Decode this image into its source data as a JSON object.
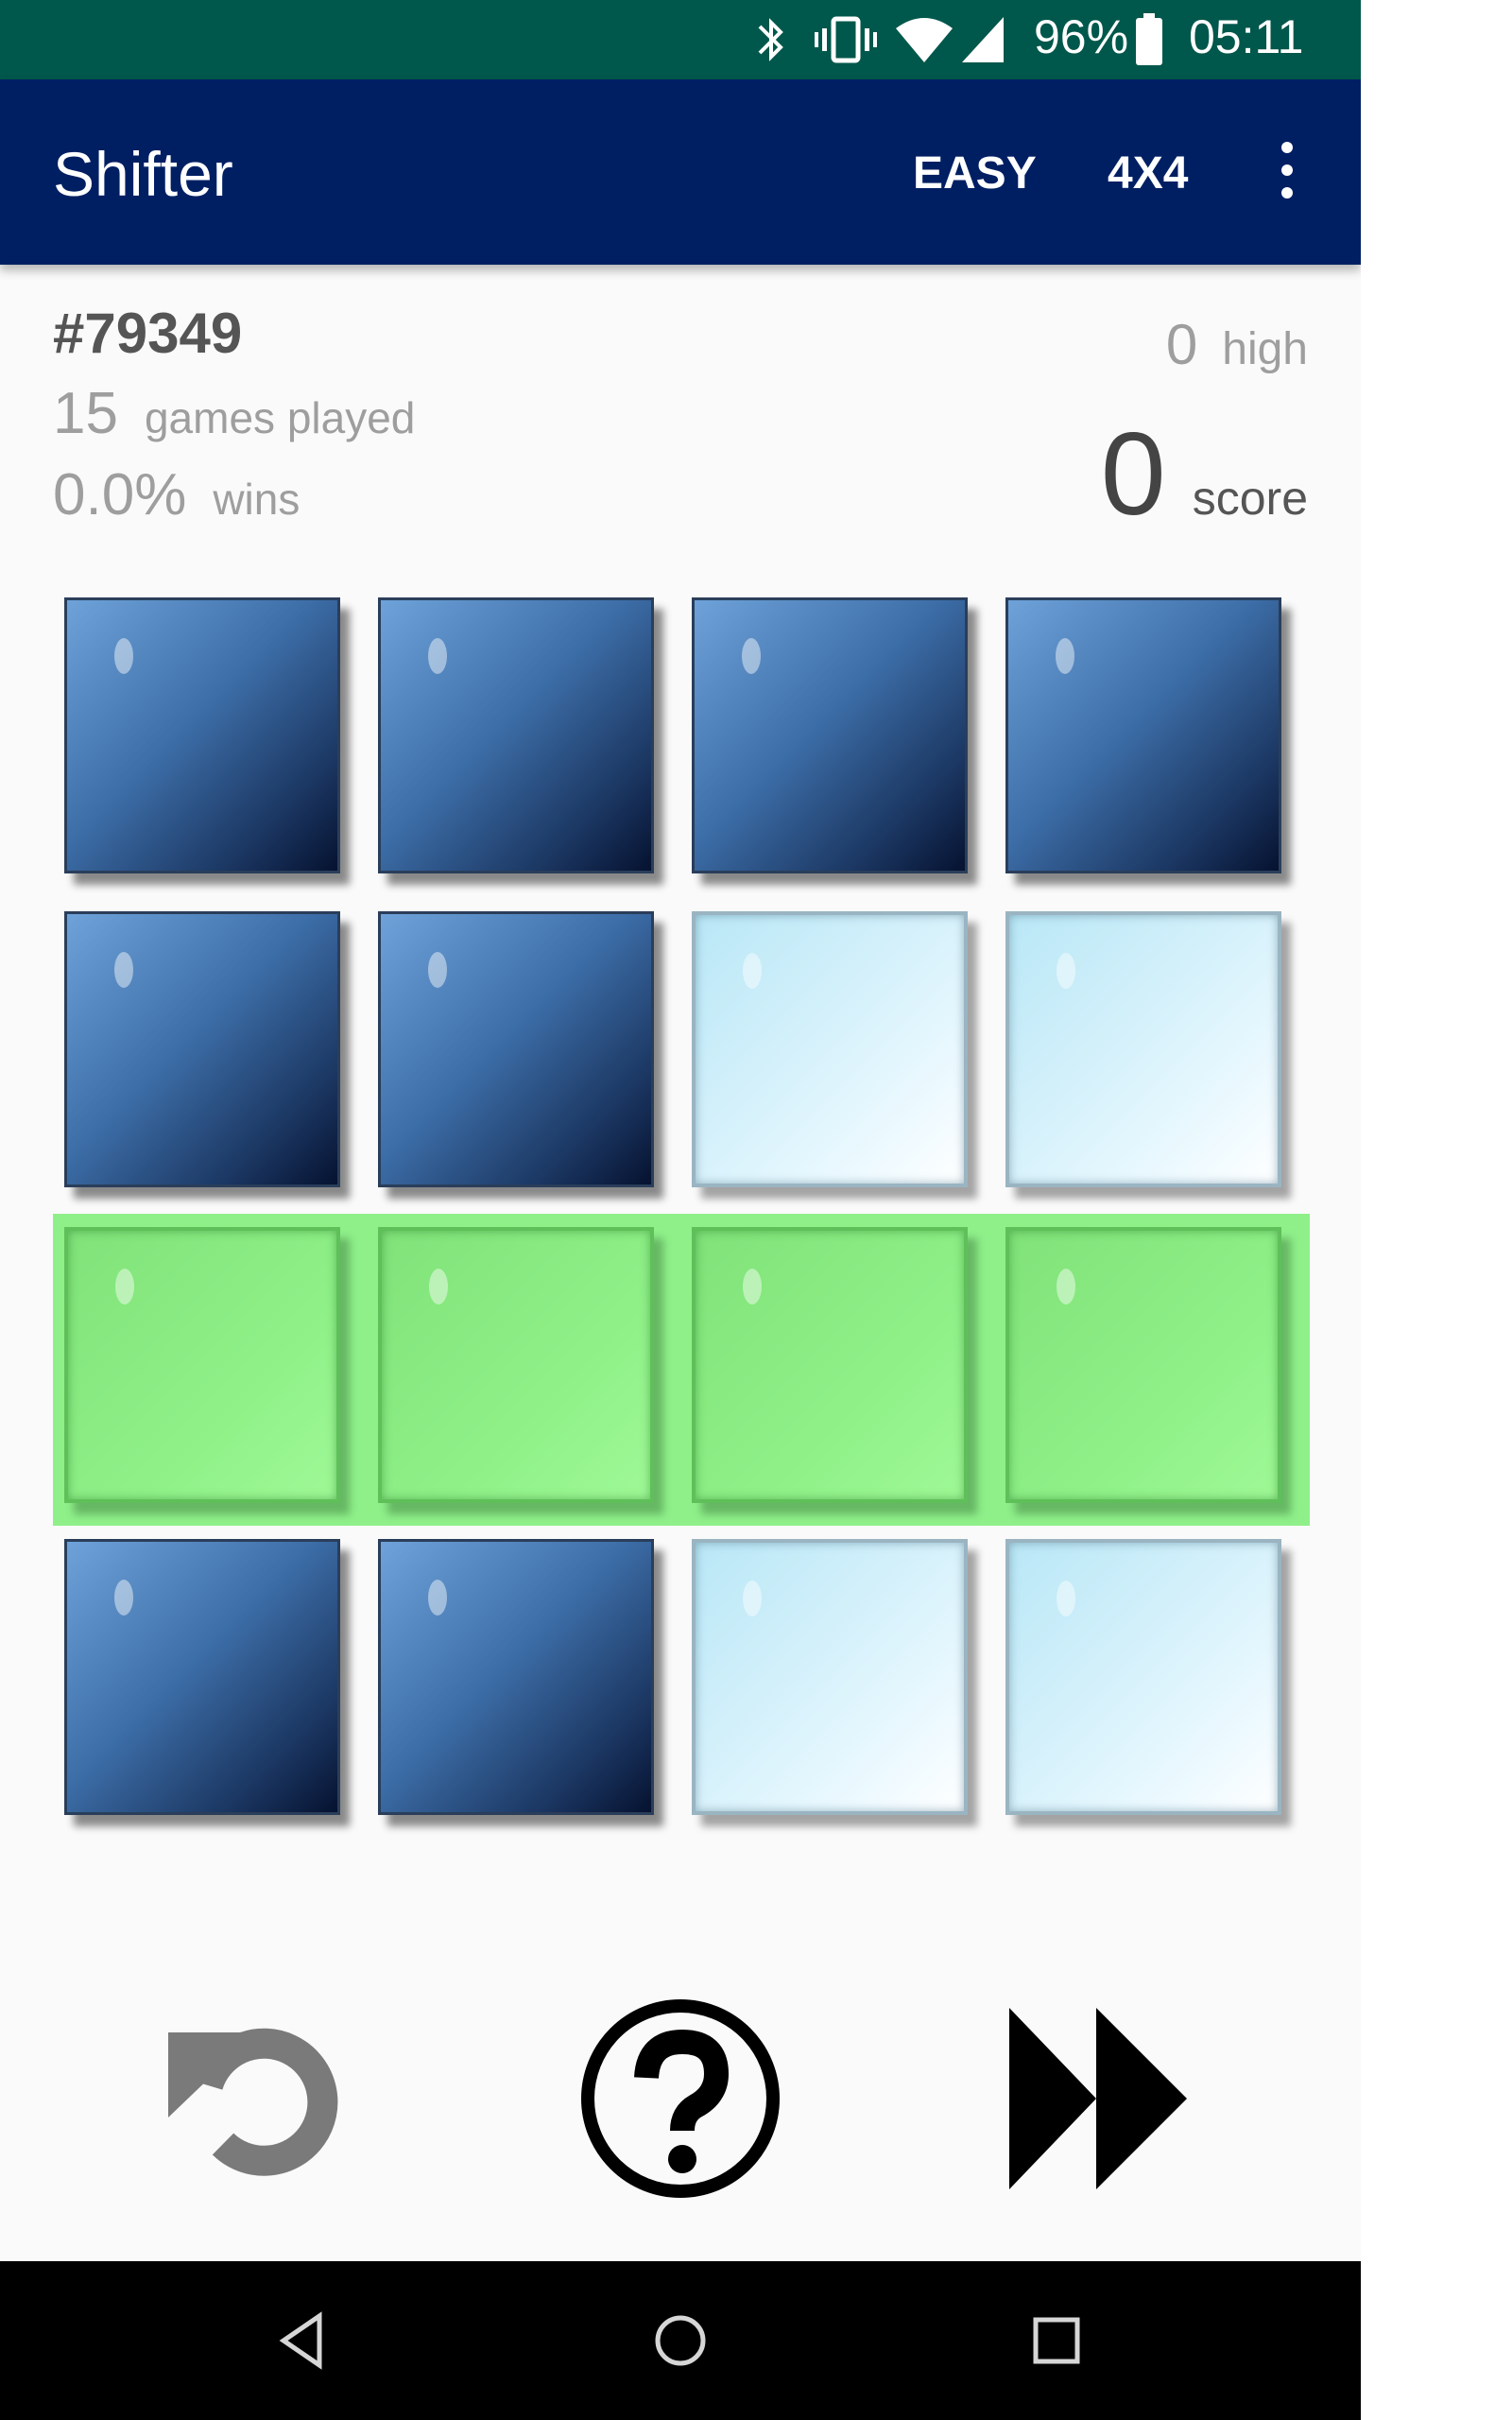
{
  "status_bar": {
    "battery": "96%",
    "time": "05:11",
    "icons": [
      "bluetooth-icon",
      "vibrate-icon",
      "wifi-icon",
      "cell-signal-icon",
      "battery-icon"
    ]
  },
  "app_bar": {
    "title": "Shifter",
    "difficulty": "EASY",
    "size": "4X4",
    "menu_icon": "more-vert-icon"
  },
  "stats": {
    "puzzle_id": "#79349",
    "games_played_value": "15",
    "games_played_label": "games played",
    "wins_value": "0.0%",
    "wins_label": "wins",
    "high_value": "0",
    "high_label": "high",
    "score_value": "0",
    "score_label": "score"
  },
  "board": {
    "size": "4x4",
    "highlighted_row": 3,
    "tiles": [
      [
        "dark",
        "dark",
        "dark",
        "dark"
      ],
      [
        "dark",
        "dark",
        "light",
        "light"
      ],
      [
        "green",
        "green",
        "green",
        "green"
      ],
      [
        "dark",
        "dark",
        "light",
        "light"
      ]
    ]
  },
  "controls": {
    "items": [
      "undo-icon",
      "help-icon",
      "skip-forward-icon"
    ]
  },
  "nav_bar": {
    "items": [
      "back-icon",
      "home-icon",
      "recents-icon"
    ]
  },
  "colors": {
    "status_bar": "#00574b",
    "app_bar": "#001f63",
    "tile_dark": "#3d6ea8",
    "tile_light": "#d5f1fb",
    "tile_green": "#8ef087",
    "highlight": "#8ff08a"
  }
}
